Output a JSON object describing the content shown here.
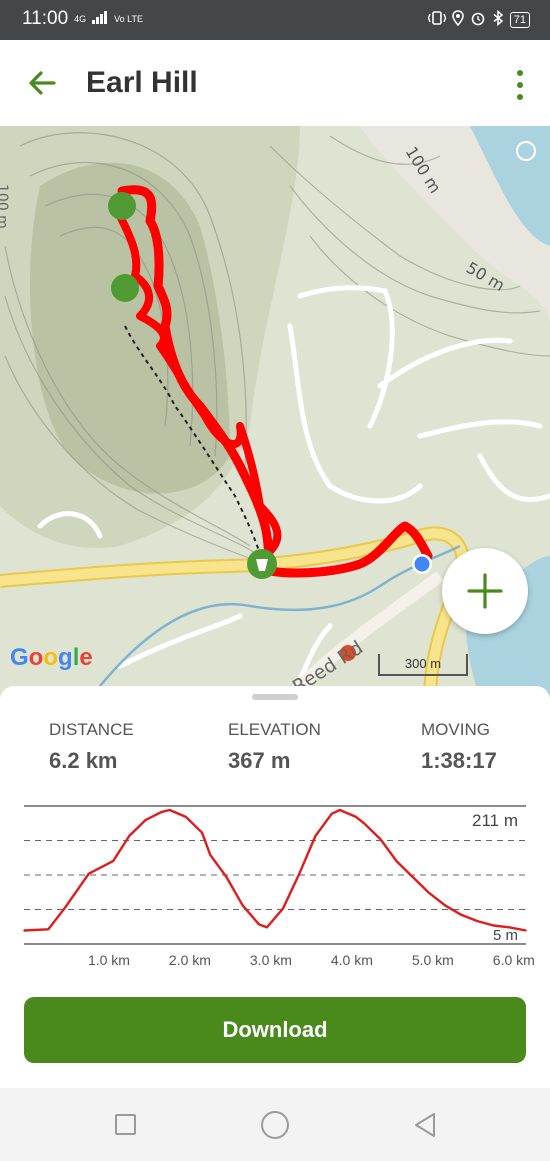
{
  "status": {
    "time": "11:00",
    "network": "4G",
    "volte": "Vo LTE",
    "battery": "71"
  },
  "header": {
    "title": "Earl Hill"
  },
  "map": {
    "contour_labels": [
      "100 m",
      "50 m",
      "100 m"
    ],
    "road_label": "Reed Rd",
    "scale_label": "300 m",
    "google_label": [
      "G",
      "o",
      "o",
      "g",
      "l",
      "e"
    ]
  },
  "stats": {
    "distance": {
      "label": "DISTANCE",
      "value": "6.2 km"
    },
    "elevation": {
      "label": "ELEVATION",
      "value": "367 m"
    },
    "moving": {
      "label": "MOVING",
      "value": "1:38:17"
    }
  },
  "chart_data": {
    "type": "area",
    "title": "",
    "xlabel": "",
    "ylabel": "",
    "xlim": [
      0,
      6.2
    ],
    "ylim": [
      5,
      211
    ],
    "x_ticks": [
      "1.0 km",
      "2.0 km",
      "3.0 km",
      "4.0 km",
      "5.0 km",
      "6.0 km"
    ],
    "y_labels": [
      "211 m",
      "5 m"
    ],
    "grid": "dashed horizontal",
    "series": [
      {
        "color": "#e21b1b",
        "x": [
          0.0,
          0.3,
          0.5,
          0.8,
          1.1,
          1.3,
          1.5,
          1.7,
          1.8,
          2.0,
          2.2,
          2.3,
          2.5,
          2.7,
          2.9,
          3.0,
          3.2,
          3.4,
          3.6,
          3.8,
          3.9,
          4.1,
          4.2,
          4.4,
          4.6,
          4.8,
          5.0,
          5.2,
          5.4,
          5.6,
          5.8,
          6.0,
          6.2
        ],
        "y": [
          20,
          22,
          55,
          110,
          130,
          170,
          195,
          208,
          211,
          200,
          175,
          140,
          105,
          60,
          30,
          25,
          55,
          110,
          170,
          205,
          211,
          200,
          190,
          165,
          130,
          105,
          80,
          60,
          45,
          35,
          28,
          25,
          20
        ]
      }
    ]
  },
  "actions": {
    "download": "Download"
  },
  "colors": {
    "brand_green": "#4a8a1c",
    "track_red": "#e21b1b",
    "statusbar": "#444648"
  }
}
